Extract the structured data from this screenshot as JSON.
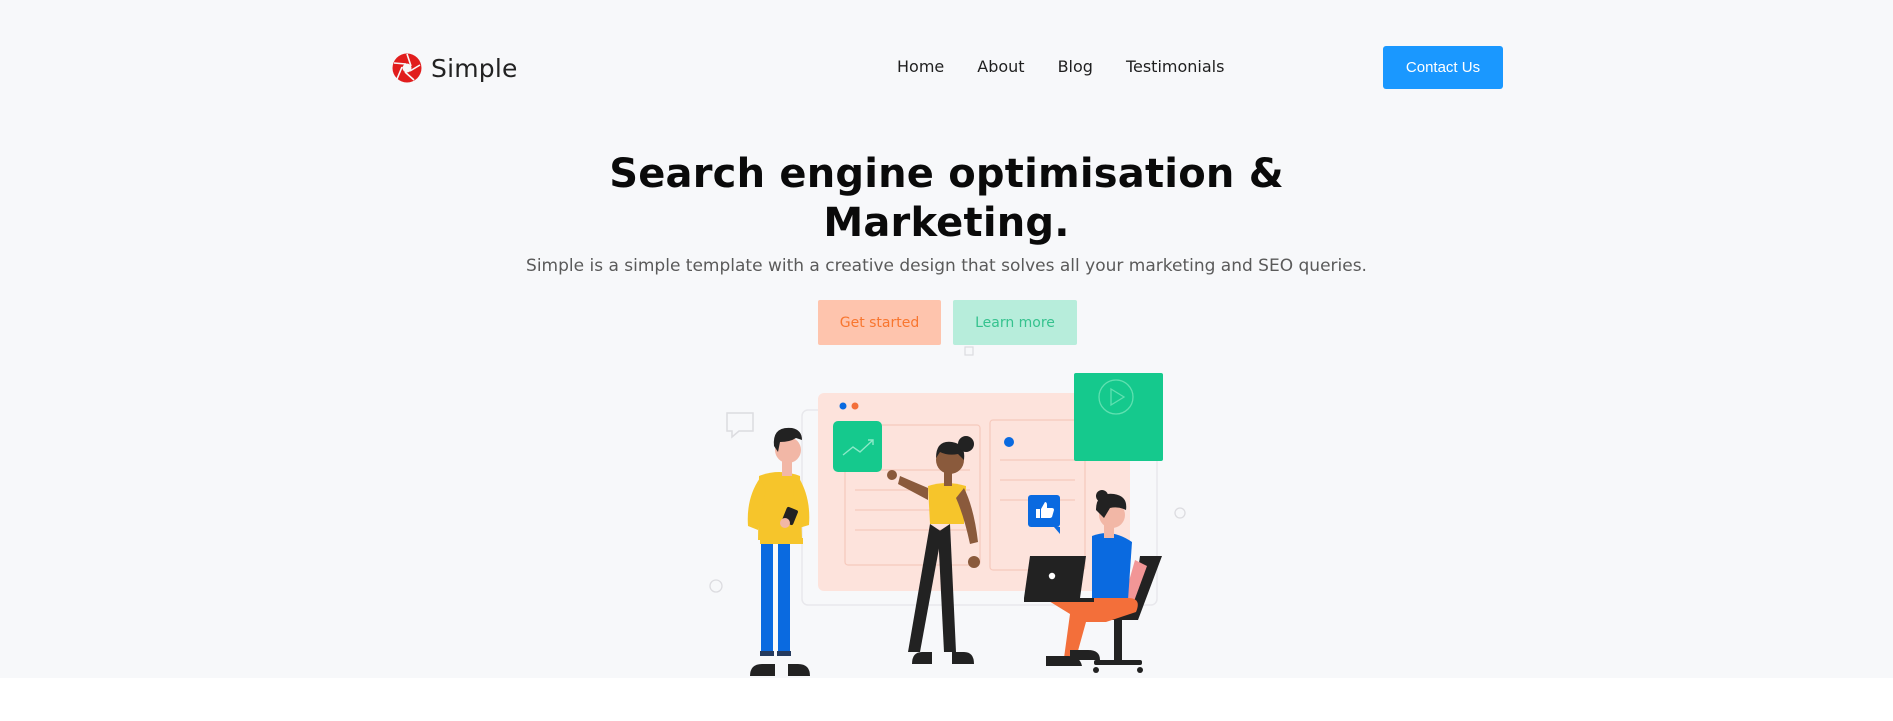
{
  "brand": {
    "name": "Simple",
    "logo_color": "#e11d1d"
  },
  "nav": {
    "items": [
      "Home",
      "About",
      "Blog",
      "Testimonials"
    ]
  },
  "header": {
    "cta_label": "Contact Us",
    "cta_color": "#1a98ff"
  },
  "hero": {
    "title": "Search engine optimisation & Marketing.",
    "subtitle": "Simple is a simple template with a creative design that solves all your marketing and SEO queries.",
    "primary_button": "Get started",
    "secondary_button": "Learn more"
  },
  "colors": {
    "background": "#f7f8fa",
    "primary_button_bg": "#fec4ad",
    "primary_button_text": "#f8762f",
    "secondary_button_bg": "#b7eddb",
    "secondary_button_text": "#35c28e",
    "accent_green": "#15c98d",
    "accent_blue": "#0a6ae0",
    "accent_yellow": "#f6c52b"
  },
  "illustration": {
    "icons": [
      "chart-icon",
      "video-play-icon",
      "thumbs-up-icon",
      "laptop-icon",
      "speech-bubble-icon"
    ]
  }
}
